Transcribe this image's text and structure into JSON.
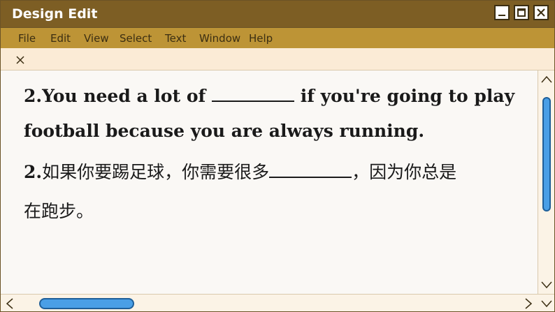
{
  "window": {
    "title": "Design Edit",
    "controls": [
      "minimize",
      "maximize",
      "close"
    ]
  },
  "menu": {
    "items": [
      "File",
      "Edit",
      "View",
      "Select",
      "Text",
      "Window",
      "Help"
    ]
  },
  "document": {
    "line1": "2.You need a lot of",
    "line1_end": "if you're going to play",
    "line2": "football because you are always running.",
    "line3_num": "2.",
    "line3": "如果你要踢足球，你需要很多",
    "line3_end": "，因为你总是",
    "line4": "在跑步。"
  },
  "colors": {
    "titlebar": "#7d5e24",
    "menubar": "#bd9436",
    "tabbar": "#fbebd6",
    "scroll_thumb": "#4a9fe6"
  },
  "icons": {
    "tab_close": "close-icon",
    "minimize": "minimize-icon",
    "maximize": "maximize-icon",
    "close": "close-icon",
    "scroll_up": "chevron-up-icon",
    "scroll_down": "chevron-down-icon",
    "scroll_left": "chevron-left-icon",
    "scroll_right": "chevron-right-icon"
  }
}
